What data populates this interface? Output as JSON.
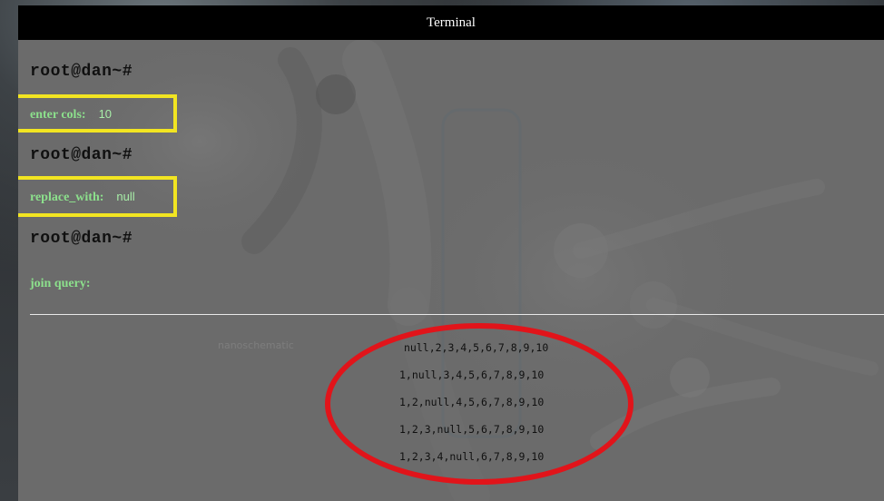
{
  "window": {
    "title": "Terminal"
  },
  "prompts": [
    "root@dan~#",
    "root@dan~#",
    "root@dan~#"
  ],
  "fields": {
    "cols_label": "enter cols:",
    "cols_value": "10",
    "replace_label": "replace_with:",
    "replace_value": "null",
    "join_label": "join query:"
  },
  "results": [
    "null,2,3,4,5,6,7,8,9,10",
    "1,null,3,4,5,6,7,8,9,10",
    "1,2,null,4,5,6,7,8,9,10",
    "1,2,3,null,5,6,7,8,9,10",
    "1,2,3,4,null,6,7,8,9,10"
  ],
  "colors": {
    "highlight_box": "#f2e521",
    "annotation_ellipse": "#e1141a",
    "field_text": "#8ce08c",
    "titlebar": "#000000"
  }
}
